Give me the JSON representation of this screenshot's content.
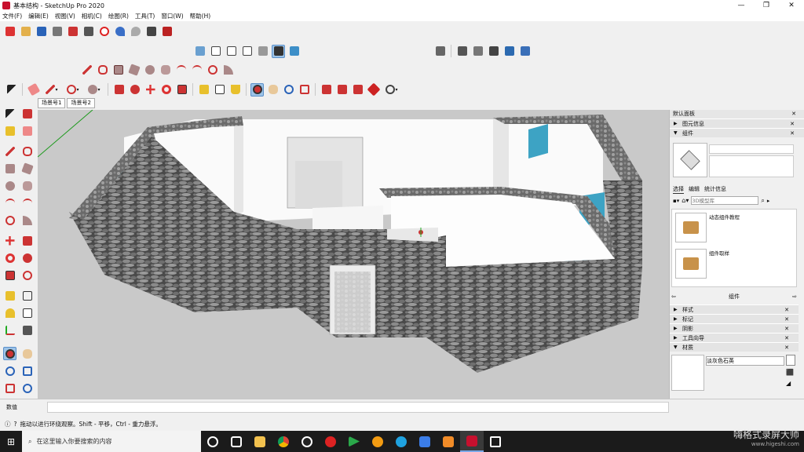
{
  "window": {
    "title": "基本结构 - SketchUp Pro 2020",
    "controls": [
      "—",
      "❐",
      "✕"
    ]
  },
  "menu": [
    "文件(F)",
    "编辑(E)",
    "视图(V)",
    "相机(C)",
    "绘图(R)",
    "工具(T)",
    "窗口(W)",
    "帮助(H)"
  ],
  "scene_tabs": [
    "场景号1",
    "场景号2"
  ],
  "vcb_label": "数值",
  "status_hint": "拖动以进行环绕观察。Shift - 平移，Ctrl - 重力悬浮。",
  "tray": {
    "title": "默认面板",
    "entity_info": "图元信息",
    "components": "组件",
    "tabs": [
      "选择",
      "编辑",
      "统计信息"
    ],
    "search_placeholder": "3D模型库",
    "items": [
      "动态组件教程",
      "组件取样"
    ],
    "nav_label": "组件",
    "panels": [
      "样式",
      "标记",
      "阴影",
      "工具向导",
      "材质"
    ],
    "material_name": "淡灰色石英"
  },
  "taskbar": {
    "search_placeholder": "在这里输入你要搜索的内容",
    "apps": [
      "cortana",
      "task-view",
      "file-explorer",
      "chrome",
      "qq",
      "netease-music",
      "media",
      "g-app",
      "edge",
      "feishu",
      "sublime",
      "sketchup",
      "camera"
    ]
  },
  "watermark": {
    "text": "嗨格式录屏大师",
    "url": "www.higeshi.com"
  },
  "colors": {
    "stone": "#5b5b5b",
    "glass": "#3da3c4",
    "interior_wall": "#ffffff",
    "sky": "#c9c9c9"
  }
}
